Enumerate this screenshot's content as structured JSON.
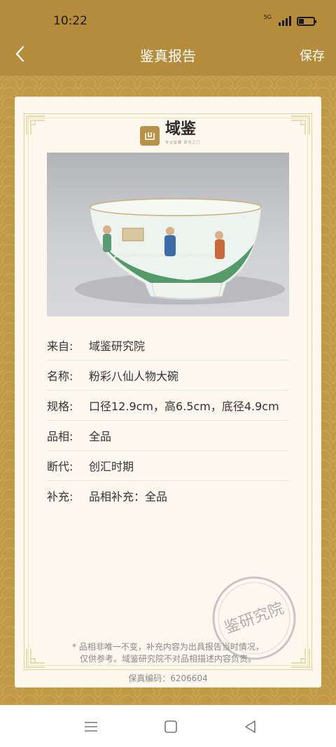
{
  "status_bar": {
    "time": "10:22",
    "network": "5G"
  },
  "header": {
    "title": "鉴真报告",
    "save_label": "保存"
  },
  "brand": {
    "name": "域鉴",
    "tagline": "专业鉴藏 研究之门",
    "mark": "凶"
  },
  "info": {
    "rows": [
      {
        "label": "来自:",
        "value": "域鉴研究院"
      },
      {
        "label": "名称:",
        "value": "粉彩八仙人物大碗"
      },
      {
        "label": "规格:",
        "value": "口径12.9cm，高6.5cm，底径4.9cm"
      },
      {
        "label": "品相:",
        "value": "全品"
      },
      {
        "label": "断代:",
        "value": "创汇时期"
      },
      {
        "label": "补充:",
        "value": "品相补充：全品"
      }
    ]
  },
  "note": {
    "line1": "* 品相非唯一不变，补充内容为出具报告当时情况，",
    "line2": "仅供参考。域鉴研究院不对品相描述内容负责。"
  },
  "code": "保真编码：6206604",
  "seal": {
    "text": "鉴研究院"
  },
  "colors": {
    "gold": "#b48c3c",
    "card": "#fdf8ee",
    "seal": "#b5b5b5"
  }
}
